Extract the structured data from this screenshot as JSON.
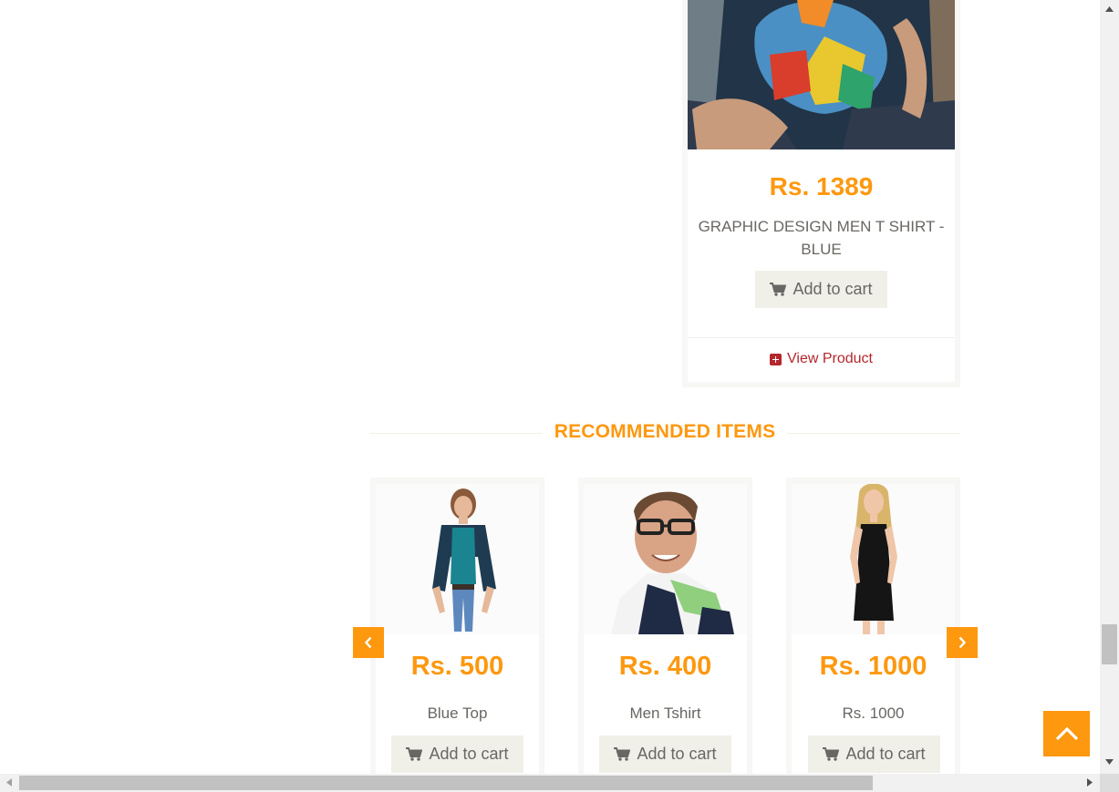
{
  "featured": {
    "price": "Rs. 1389",
    "name": "GRAPHIC DESIGN MEN T SHIRT - BLUE",
    "add_to_cart": "Add to cart",
    "view_product": "View Product"
  },
  "recommended": {
    "title": "RECOMMENDED ITEMS",
    "items": [
      {
        "price": "Rs. 500",
        "name": "Blue Top",
        "add_to_cart": "Add to cart"
      },
      {
        "price": "Rs. 400",
        "name": "Men Tshirt",
        "add_to_cart": "Add to cart"
      },
      {
        "price": "Rs. 1000",
        "name": "Rs. 1000",
        "add_to_cart": "Add to cart"
      }
    ]
  },
  "colors": {
    "accent": "#FE980F",
    "view_product": "#B3272D",
    "button_bg": "#F0F0E9",
    "text": "#696763"
  },
  "icons": {
    "cart": "shopping-cart-icon",
    "view": "plus-square-icon",
    "prev": "chevron-left-icon",
    "next": "chevron-right-icon",
    "scroll_up": "chevron-up-icon"
  }
}
